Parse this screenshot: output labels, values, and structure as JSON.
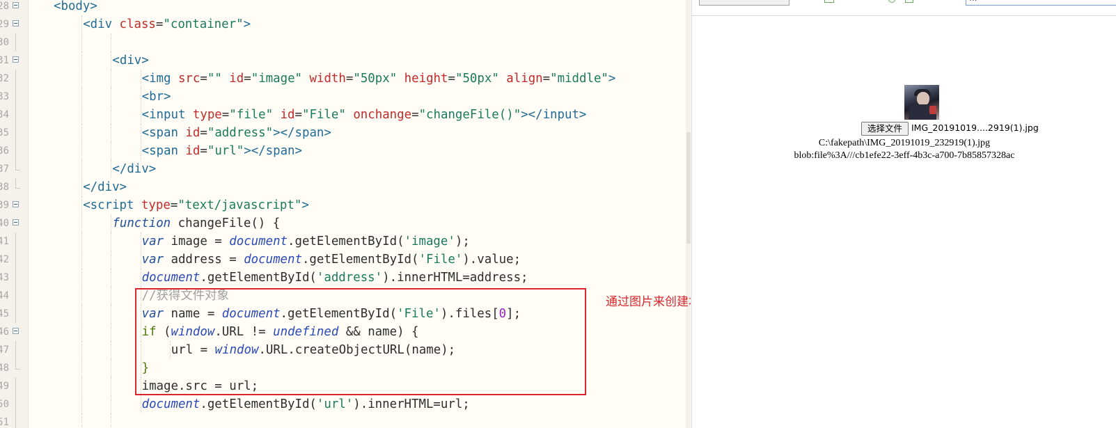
{
  "editor": {
    "lines": [
      {
        "num": "28",
        "fold": "open",
        "indent": 0,
        "tokens": [
          [
            "tag",
            "<body>"
          ]
        ]
      },
      {
        "num": "29",
        "fold": "open",
        "indent": 1,
        "tokens": [
          [
            "tag",
            "<div "
          ],
          [
            "attr",
            "class"
          ],
          [
            "punct",
            "="
          ],
          [
            "str",
            "\"container\""
          ],
          [
            "tag",
            ">"
          ]
        ]
      },
      {
        "num": "30",
        "fold": "line",
        "indent": 0,
        "tokens": []
      },
      {
        "num": "31",
        "fold": "open",
        "indent": 2,
        "tokens": [
          [
            "tag",
            "<div>"
          ]
        ]
      },
      {
        "num": "32",
        "fold": "line",
        "indent": 3,
        "tokens": [
          [
            "tag",
            "<img "
          ],
          [
            "attr",
            "src"
          ],
          [
            "punct",
            "="
          ],
          [
            "str",
            "\"\""
          ],
          [
            "ident",
            " "
          ],
          [
            "attr",
            "id"
          ],
          [
            "punct",
            "="
          ],
          [
            "str",
            "\"image\""
          ],
          [
            "ident",
            " "
          ],
          [
            "attr",
            "width"
          ],
          [
            "punct",
            "="
          ],
          [
            "str",
            "\"50px\""
          ],
          [
            "ident",
            " "
          ],
          [
            "attr",
            "height"
          ],
          [
            "punct",
            "="
          ],
          [
            "str",
            "\"50px\""
          ],
          [
            "ident",
            " "
          ],
          [
            "attr",
            "align"
          ],
          [
            "punct",
            "="
          ],
          [
            "str",
            "\"middle\""
          ],
          [
            "tag",
            ">"
          ]
        ]
      },
      {
        "num": "33",
        "fold": "line",
        "indent": 3,
        "tokens": [
          [
            "tag",
            "<br>"
          ]
        ]
      },
      {
        "num": "34",
        "fold": "line",
        "indent": 3,
        "tokens": [
          [
            "tag",
            "<input "
          ],
          [
            "attr",
            "type"
          ],
          [
            "punct",
            "="
          ],
          [
            "str",
            "\"file\""
          ],
          [
            "ident",
            " "
          ],
          [
            "attr",
            "id"
          ],
          [
            "punct",
            "="
          ],
          [
            "str",
            "\"File\""
          ],
          [
            "ident",
            " "
          ],
          [
            "attr",
            "onchange"
          ],
          [
            "punct",
            "="
          ],
          [
            "str",
            "\"changeFile()\""
          ],
          [
            "tag",
            "></input>"
          ]
        ]
      },
      {
        "num": "35",
        "fold": "line",
        "indent": 3,
        "tokens": [
          [
            "tag",
            "<span "
          ],
          [
            "attr",
            "id"
          ],
          [
            "punct",
            "="
          ],
          [
            "str",
            "\"address\""
          ],
          [
            "tag",
            "></span>"
          ]
        ]
      },
      {
        "num": "36",
        "fold": "line",
        "indent": 3,
        "tokens": [
          [
            "tag",
            "<span "
          ],
          [
            "attr",
            "id"
          ],
          [
            "punct",
            "="
          ],
          [
            "str",
            "\"url\""
          ],
          [
            "tag",
            "></span>"
          ]
        ]
      },
      {
        "num": "37",
        "fold": "end",
        "indent": 2,
        "tokens": [
          [
            "tag",
            "</div>"
          ]
        ]
      },
      {
        "num": "38",
        "fold": "end",
        "indent": 1,
        "tokens": [
          [
            "tag",
            "</div>"
          ]
        ]
      },
      {
        "num": "39",
        "fold": "open",
        "indent": 1,
        "tokens": [
          [
            "tag",
            "<script "
          ],
          [
            "attr",
            "type"
          ],
          [
            "punct",
            "="
          ],
          [
            "str",
            "\"text/javascript\""
          ],
          [
            "tag",
            ">"
          ]
        ]
      },
      {
        "num": "40",
        "fold": "open",
        "indent": 2,
        "tokens": [
          [
            "kw",
            "function"
          ],
          [
            "ident",
            " changeFile() {"
          ]
        ]
      },
      {
        "num": "41",
        "fold": "line",
        "indent": 3,
        "tokens": [
          [
            "kw",
            "var"
          ],
          [
            "ident",
            " image = "
          ],
          [
            "obj",
            "document"
          ],
          [
            "ident",
            ".getElementById("
          ],
          [
            "str",
            "'image'"
          ],
          [
            "ident",
            ");"
          ]
        ]
      },
      {
        "num": "42",
        "fold": "line",
        "indent": 3,
        "tokens": [
          [
            "kw",
            "var"
          ],
          [
            "ident",
            " address = "
          ],
          [
            "obj",
            "document"
          ],
          [
            "ident",
            ".getElementById("
          ],
          [
            "str",
            "'File'"
          ],
          [
            "ident",
            ").value;"
          ]
        ]
      },
      {
        "num": "43",
        "fold": "line",
        "indent": 3,
        "tokens": [
          [
            "obj",
            "document"
          ],
          [
            "ident",
            ".getElementById("
          ],
          [
            "str",
            "'address'"
          ],
          [
            "ident",
            ").innerHTML=address;"
          ]
        ]
      },
      {
        "num": "44",
        "fold": "line",
        "indent": 3,
        "tokens": [
          [
            "cmt",
            "//获得文件对象"
          ]
        ]
      },
      {
        "num": "45",
        "fold": "line",
        "indent": 3,
        "tokens": [
          [
            "kw",
            "var"
          ],
          [
            "ident",
            " name = "
          ],
          [
            "obj",
            "document"
          ],
          [
            "ident",
            ".getElementById("
          ],
          [
            "str",
            "'File'"
          ],
          [
            "ident",
            ").files["
          ],
          [
            "num",
            "0"
          ],
          [
            "ident",
            "];"
          ]
        ]
      },
      {
        "num": "46",
        "fold": "open",
        "indent": 3,
        "tokens": [
          [
            "kw2",
            "if"
          ],
          [
            "ident",
            " ("
          ],
          [
            "obj",
            "window"
          ],
          [
            "ident",
            ".URL != "
          ],
          [
            "obj",
            "undefined"
          ],
          [
            "ident",
            " && name) {"
          ]
        ]
      },
      {
        "num": "47",
        "fold": "line",
        "indent": 4,
        "tokens": [
          [
            "ident",
            "url = "
          ],
          [
            "obj",
            "window"
          ],
          [
            "ident",
            ".URL.createObjectURL(name);"
          ]
        ]
      },
      {
        "num": "48",
        "fold": "end",
        "indent": 3,
        "tokens": [
          [
            "kw2",
            "}"
          ]
        ]
      },
      {
        "num": "49",
        "fold": "line",
        "indent": 3,
        "tokens": [
          [
            "ident",
            "image.src = url;"
          ]
        ]
      },
      {
        "num": "50",
        "fold": "line",
        "indent": 3,
        "tokens": [
          [
            "obj",
            "document"
          ],
          [
            "ident",
            ".getElementById("
          ],
          [
            "str",
            "'url'"
          ],
          [
            "ident",
            ").innerHTML=url;"
          ]
        ]
      },
      {
        "num": "51",
        "fold": "line",
        "indent": 0,
        "tokens": []
      }
    ]
  },
  "annotation": {
    "text": "通过图片来创建本地链接，以便渲染图片",
    "color": "#d9262c"
  },
  "preview": {
    "toolbar_input_text": "...",
    "file_button_label": "选择文件",
    "file_name": "IMG_20191019....2919(1).jpg",
    "address": "C:\\fakepath\\IMG_20191019_232919(1).jpg",
    "url": "blob:file%3A///cb1efe22-3eff-4b3c-a700-7b85857328ac"
  }
}
